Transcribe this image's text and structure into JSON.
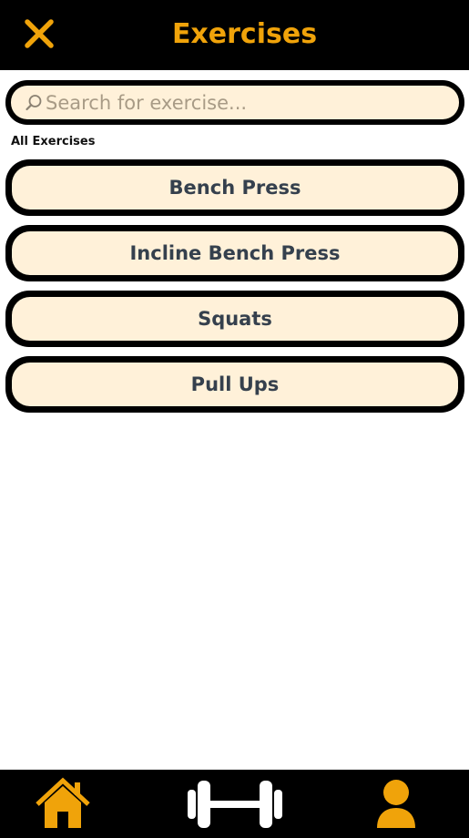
{
  "header": {
    "title": "Exercises",
    "close_icon": "close-icon",
    "accent_color": "#f0a30a"
  },
  "search": {
    "placeholder": "Search for exercise...",
    "value": "",
    "icon": "search-icon"
  },
  "section": {
    "label": "All Exercises"
  },
  "exercises": [
    {
      "label": "Bench Press"
    },
    {
      "label": "Incline Bench Press"
    },
    {
      "label": "Squats"
    },
    {
      "label": "Pull Ups"
    }
  ],
  "bottom_nav": {
    "items": [
      {
        "icon": "home-icon",
        "color": "#f0a30a"
      },
      {
        "icon": "barbell-icon",
        "color": "#ffffff"
      },
      {
        "icon": "profile-icon",
        "color": "#f0a30a"
      }
    ]
  },
  "colors": {
    "bar_background": "#000000",
    "card_fill": "#fff1d9",
    "card_text": "#35404d"
  }
}
